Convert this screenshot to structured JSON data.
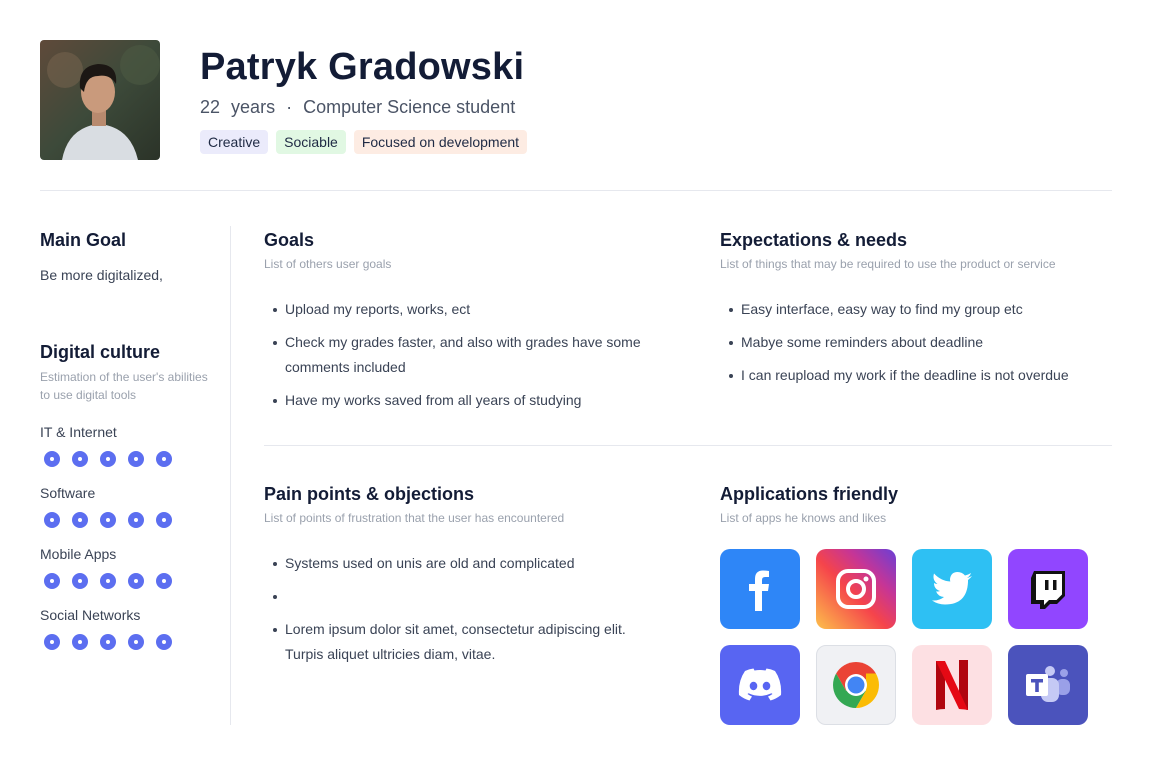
{
  "profile": {
    "name": "Patryk Gradowski",
    "age": "22",
    "age_unit": "years",
    "separator": "·",
    "occupation": "Computer Science student",
    "tags": [
      {
        "label": "Creative",
        "color": "#ebebfb"
      },
      {
        "label": "Sociable",
        "color": "#e1f8e3"
      },
      {
        "label": "Focused on development",
        "color": "#fdece3"
      }
    ]
  },
  "main_goal": {
    "title": "Main Goal",
    "text": "Be more digitalized,"
  },
  "digital_culture": {
    "title": "Digital culture",
    "subtitle": "Estimation of the user's abilities to use digital tools",
    "skills": [
      {
        "label": "IT & Internet",
        "rating": 5
      },
      {
        "label": "Software",
        "rating": 5
      },
      {
        "label": "Mobile Apps",
        "rating": 5
      },
      {
        "label": "Social Networks",
        "rating": 5
      }
    ]
  },
  "goals": {
    "title": "Goals",
    "subtitle": "List of others user goals",
    "items": [
      "Upload my reports, works, ect",
      "Check my grades faster, and also with grades have some comments included",
      "Have my works saved from all years of studying"
    ]
  },
  "expectations": {
    "title": "Expectations & needs",
    "subtitle": "List of things that may be required to use the product or service",
    "items": [
      "Easy interface, easy way to find my group etc",
      "Mabye some reminders about deadline",
      "I can reupload my work if the deadline is not overdue"
    ]
  },
  "pain_points": {
    "title": "Pain points & objections",
    "subtitle": "List of points of frustration that the user has encountered",
    "items": [
      "Systems used on unis are old and complicated",
      "",
      "Lorem ipsum dolor sit amet, consectetur adipiscing elit. Turpis aliquet ultricies diam, vitae."
    ]
  },
  "applications": {
    "title": "Applications friendly",
    "subtitle": "List of apps he knows and likes",
    "apps": [
      {
        "icon": "facebook-icon",
        "color": "#2e86f7"
      },
      {
        "icon": "instagram-icon",
        "color": "#c13584"
      },
      {
        "icon": "twitter-icon",
        "color": "#2ec0f3"
      },
      {
        "icon": "twitch-icon",
        "color": "#9146ff"
      },
      {
        "icon": "discord-icon",
        "color": "#5865f2"
      },
      {
        "icon": "chrome-icon",
        "color": "#f0f1f4"
      },
      {
        "icon": "netflix-icon",
        "color": "#fde0e3"
      },
      {
        "icon": "teams-icon",
        "color": "#4b53bc"
      }
    ]
  },
  "colors": {
    "accent": "#5c6ef0",
    "heading": "#131c36",
    "muted": "#9aa1ad"
  }
}
